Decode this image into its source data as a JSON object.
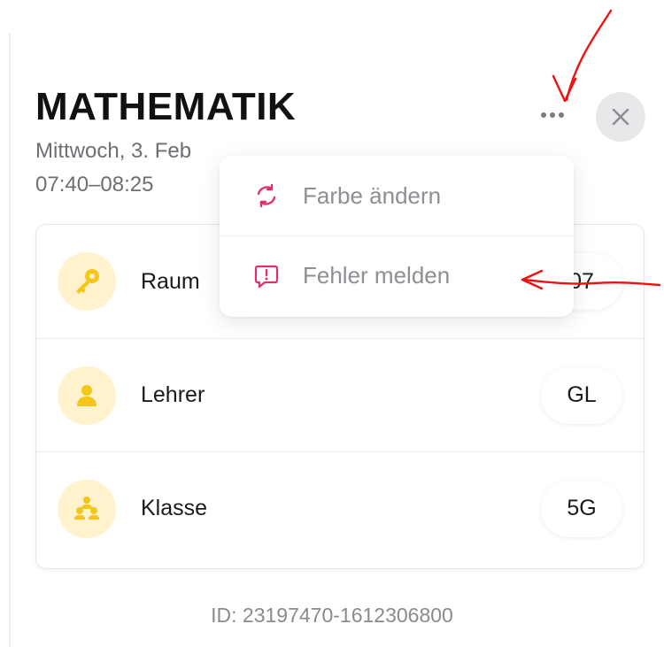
{
  "header": {
    "title": "MATHEMATIK",
    "date": "Mittwoch, 3. Feb",
    "time": "07:40–08:25"
  },
  "actions": {
    "more_icon": "more-horizontal-icon",
    "close_icon": "close-icon"
  },
  "menu": {
    "items": [
      {
        "label": "Farbe ändern",
        "icon": "refresh-icon"
      },
      {
        "label": "Fehler melden",
        "icon": "report-icon"
      }
    ]
  },
  "details": {
    "rows": [
      {
        "label": "Raum",
        "value": "07",
        "icon": "key-icon"
      },
      {
        "label": "Lehrer",
        "value": "GL",
        "icon": "person-icon"
      },
      {
        "label": "Klasse",
        "value": "5G",
        "icon": "class-group-icon"
      }
    ]
  },
  "footer": {
    "id_text": "ID: 23197470-1612306800"
  },
  "colors": {
    "accent_icon": "#f5c51a",
    "icon_bg": "#fff2cc",
    "menu_icon": "#e0306a",
    "annotation": "#ee1111"
  }
}
